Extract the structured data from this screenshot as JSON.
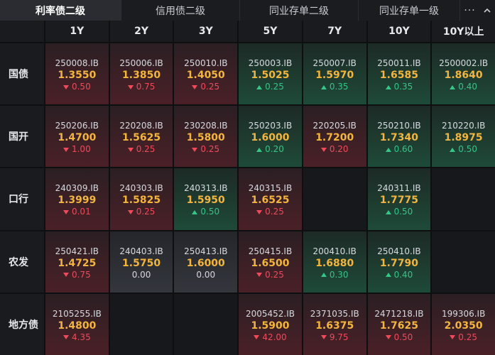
{
  "tabs": [
    {
      "label": "利率债二级",
      "active": true
    },
    {
      "label": "信用债二级",
      "active": false
    },
    {
      "label": "同业存单二级",
      "active": false
    },
    {
      "label": "同业存单一级",
      "active": false
    }
  ],
  "more_label": "···",
  "columns": [
    "1Y",
    "2Y",
    "3Y",
    "5Y",
    "7Y",
    "10Y",
    "10Y以上"
  ],
  "colors": {
    "up": "#35c688",
    "down": "#f14a5a",
    "rate": "#f3b53c"
  },
  "rows": [
    {
      "label": "国债",
      "cells": [
        {
          "code": "250008.IB",
          "rate": "1.3550",
          "change": "0.50",
          "dir": "down"
        },
        {
          "code": "250006.IB",
          "rate": "1.3850",
          "change": "0.75",
          "dir": "down"
        },
        {
          "code": "250010.IB",
          "rate": "1.4050",
          "change": "0.25",
          "dir": "down"
        },
        {
          "code": "250003.IB",
          "rate": "1.5025",
          "change": "0.25",
          "dir": "up"
        },
        {
          "code": "250007.IB",
          "rate": "1.5970",
          "change": "0.35",
          "dir": "up"
        },
        {
          "code": "250011.IB",
          "rate": "1.6585",
          "change": "0.35",
          "dir": "up"
        },
        {
          "code": "2500002.IB",
          "rate": "1.8640",
          "change": "0.40",
          "dir": "up"
        }
      ]
    },
    {
      "label": "国开",
      "cells": [
        {
          "code": "250206.IB",
          "rate": "1.4700",
          "change": "1.00",
          "dir": "down"
        },
        {
          "code": "220208.IB",
          "rate": "1.5625",
          "change": "0.25",
          "dir": "down"
        },
        {
          "code": "230208.IB",
          "rate": "1.5800",
          "change": "0.25",
          "dir": "down"
        },
        {
          "code": "250203.IB",
          "rate": "1.6000",
          "change": "0.20",
          "dir": "up"
        },
        {
          "code": "220205.IB",
          "rate": "1.7200",
          "change": "0.20",
          "dir": "down"
        },
        {
          "code": "250210.IB",
          "rate": "1.7340",
          "change": "0.60",
          "dir": "up"
        },
        {
          "code": "210220.IB",
          "rate": "1.8975",
          "change": "0.50",
          "dir": "up"
        }
      ]
    },
    {
      "label": "口行",
      "cells": [
        {
          "code": "240309.IB",
          "rate": "1.3999",
          "change": "0.01",
          "dir": "down"
        },
        {
          "code": "240303.IB",
          "rate": "1.5825",
          "change": "0.25",
          "dir": "down"
        },
        {
          "code": "240313.IB",
          "rate": "1.5950",
          "change": "0.50",
          "dir": "up"
        },
        {
          "code": "240315.IB",
          "rate": "1.6525",
          "change": "0.25",
          "dir": "down"
        },
        null,
        {
          "code": "240311.IB",
          "rate": "1.7775",
          "change": "0.50",
          "dir": "up"
        },
        null
      ]
    },
    {
      "label": "农发",
      "cells": [
        {
          "code": "250421.IB",
          "rate": "1.4725",
          "change": "0.75",
          "dir": "down"
        },
        {
          "code": "240403.IB",
          "rate": "1.5750",
          "change": "0.00",
          "dir": "flat"
        },
        {
          "code": "250413.IB",
          "rate": "1.6000",
          "change": "0.00",
          "dir": "flat"
        },
        {
          "code": "250415.IB",
          "rate": "1.6500",
          "change": "0.25",
          "dir": "down"
        },
        {
          "code": "200410.IB",
          "rate": "1.6880",
          "change": "0.30",
          "dir": "up"
        },
        {
          "code": "250410.IB",
          "rate": "1.7790",
          "change": "0.40",
          "dir": "up"
        },
        null
      ]
    },
    {
      "label": "地方债",
      "cells": [
        {
          "code": "2105255.IB",
          "rate": "1.4800",
          "change": "4.35",
          "dir": "down"
        },
        null,
        null,
        {
          "code": "2005452.IB",
          "rate": "1.5900",
          "change": "42.00",
          "dir": "down"
        },
        {
          "code": "2371035.IB",
          "rate": "1.6375",
          "change": "9.75",
          "dir": "down"
        },
        {
          "code": "2471218.IB",
          "rate": "1.7625",
          "change": "0.50",
          "dir": "down"
        },
        {
          "code": "199306.IB",
          "rate": "2.0350",
          "change": "0.25",
          "dir": "down"
        }
      ]
    }
  ]
}
